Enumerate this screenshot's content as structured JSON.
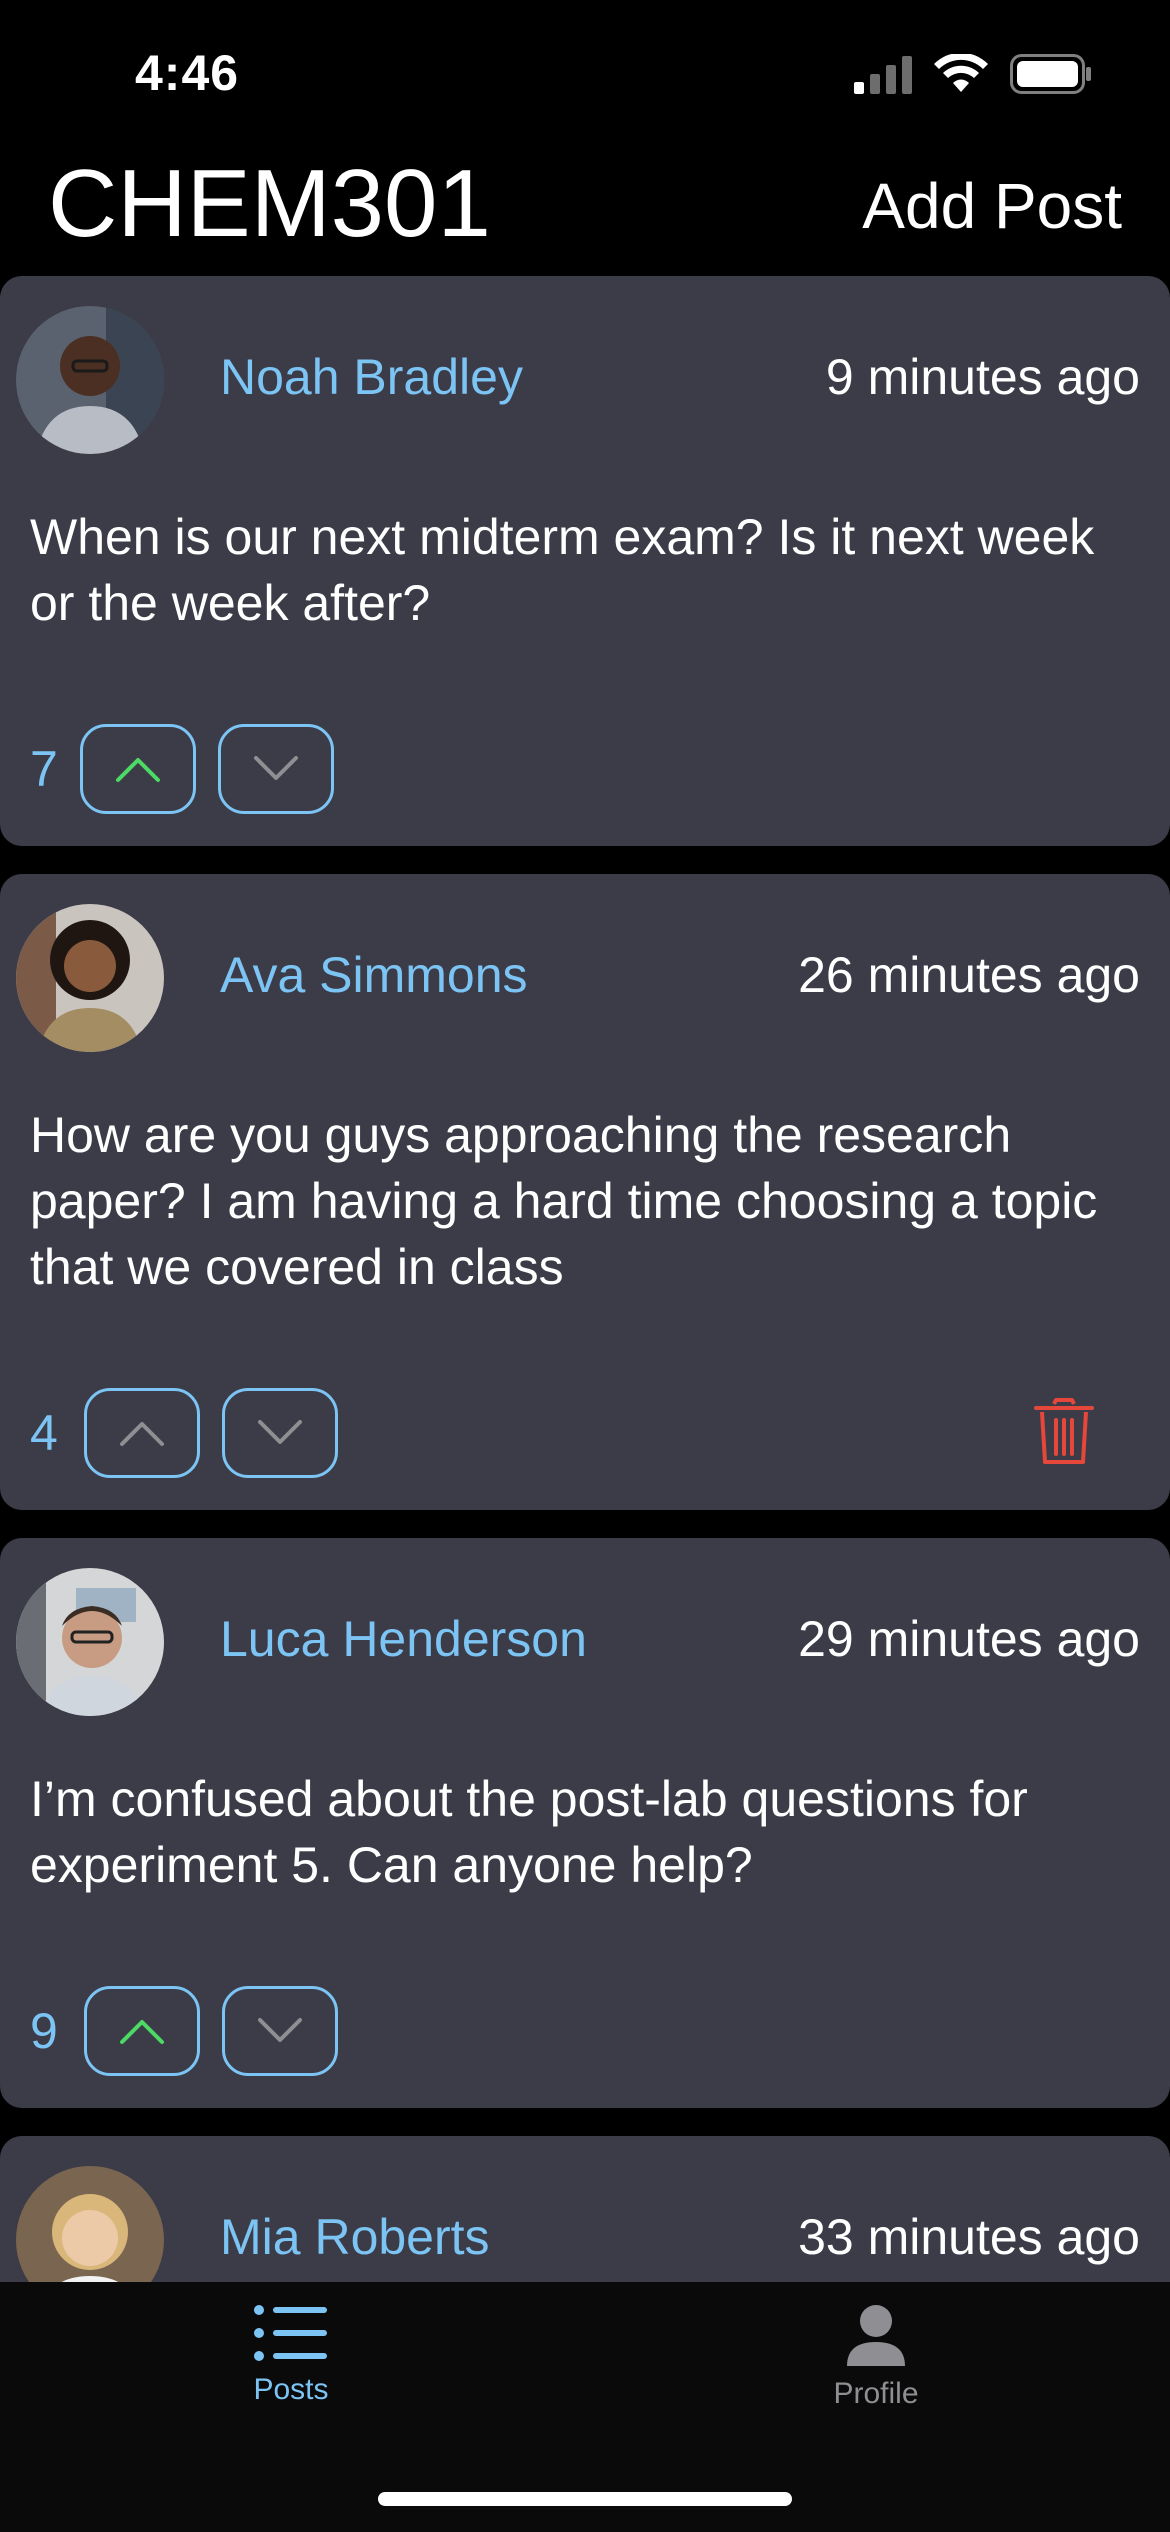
{
  "status_bar": {
    "time": "4:46"
  },
  "header": {
    "title": "CHEM301",
    "add_post_label": "Add Post"
  },
  "posts": [
    {
      "author": "Noah Bradley",
      "time": "9 minutes ago",
      "text": "When is our next midterm exam? Is it next week or the week after?",
      "votes": "7",
      "upvoted": true
    },
    {
      "author": "Ava Simmons",
      "time": "26 minutes ago",
      "text": "How are you guys approaching the research paper? I am having a hard time choosing a topic that we covered in class",
      "votes": "4",
      "upvoted": false,
      "deletable": true
    },
    {
      "author": "Luca Henderson",
      "time": "29 minutes ago",
      "text": "I’m confused about the post-lab questions for experiment 5. Can anyone help?",
      "votes": "9",
      "upvoted": true
    },
    {
      "author": "Mia Roberts",
      "time": "33 minutes ago"
    }
  ],
  "tab_bar": {
    "tabs": [
      {
        "label": "Posts",
        "icon": "list-icon",
        "active": true
      },
      {
        "label": "Profile",
        "icon": "person-icon",
        "active": false
      }
    ]
  },
  "colors": {
    "accent": "#7cc4f4",
    "card": "#3c3c48",
    "upvote_active": "#4cd964",
    "delete": "#e5473a",
    "inactive": "#8e8e93"
  }
}
